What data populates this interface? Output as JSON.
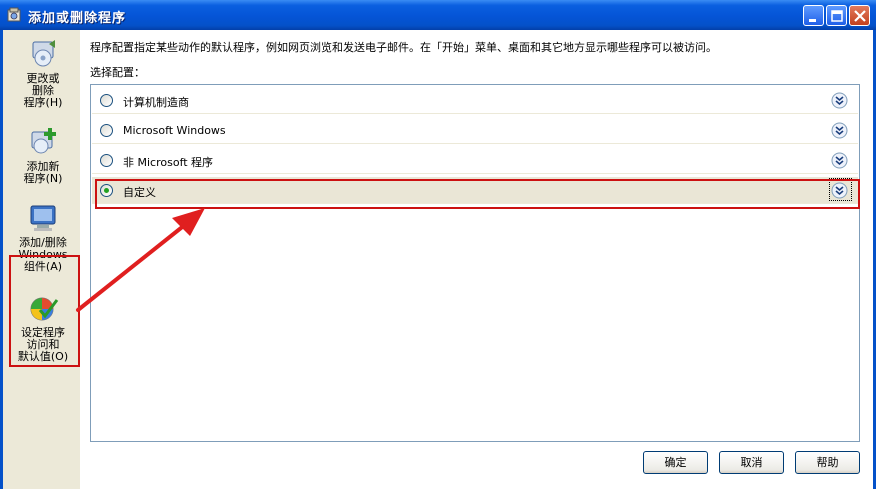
{
  "window": {
    "title": "添加或删除程序"
  },
  "sidebar": {
    "items": [
      {
        "label_lines": [
          "更改或",
          "删除",
          "程序(H)"
        ],
        "icon": "change-remove-programs-icon"
      },
      {
        "label_lines": [
          "添加新",
          "程序(N)"
        ],
        "icon": "add-new-programs-icon"
      },
      {
        "label_lines": [
          "添加/删除",
          "Windows",
          "组件(A)"
        ],
        "icon": "windows-components-icon"
      },
      {
        "label_lines": [
          "设定程序",
          "访问和",
          "默认值(O)"
        ],
        "icon": "program-access-defaults-icon",
        "selected": true
      }
    ]
  },
  "main": {
    "description": "程序配置指定某些动作的默认程序，例如网页浏览和发送电子邮件。在「开始」菜单、桌面和其它地方显示哪些程序可以被访问。",
    "config_label": "选择配置：",
    "options": [
      {
        "label": "计算机制造商",
        "checked": false
      },
      {
        "label": "Microsoft Windows",
        "checked": false
      },
      {
        "label": "非 Microsoft 程序",
        "checked": false
      },
      {
        "label": "自定义",
        "checked": true
      }
    ]
  },
  "buttons": {
    "ok": "确定",
    "cancel": "取消",
    "help": "帮助"
  },
  "colors": {
    "title_bar": "#0554d6",
    "sidebar_bg": "#ece9d8",
    "highlight_red": "#cc1111",
    "selected_row": "#eae6d6"
  }
}
